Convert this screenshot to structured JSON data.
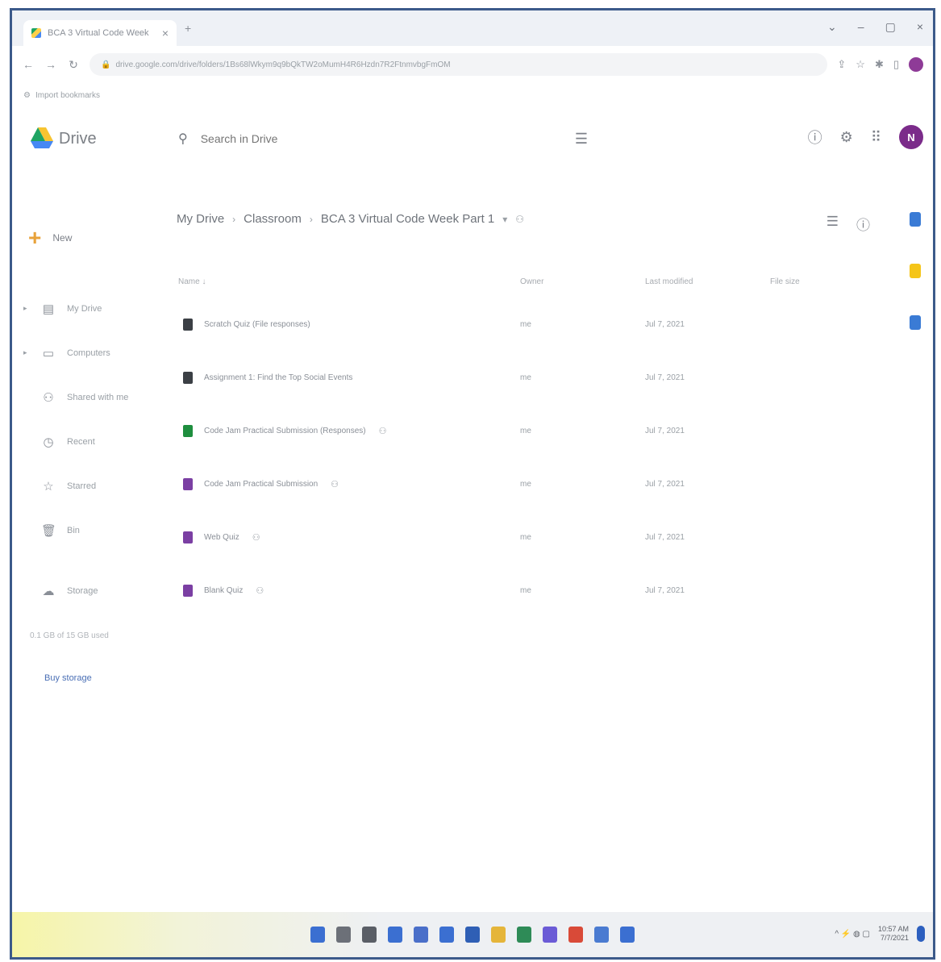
{
  "browser": {
    "tab_title": "BCA 3 Virtual Code Week",
    "tab_close": "×",
    "new_tab": "+",
    "window_controls": [
      "⌄",
      "–",
      "▢",
      "×"
    ],
    "url": "drive.google.com/drive/folders/1Bs68lWkym9q9bQkTW2oMumH4R6Hzdn7R2FtnmvbgFmOM",
    "bookmark": "Import bookmarks"
  },
  "drive": {
    "brand": "Drive",
    "search_placeholder": "Search in Drive",
    "avatar_initial": "N",
    "new_label": "New",
    "nav": [
      {
        "label": "My Drive",
        "icon": "my-drive-icon",
        "glyph": "▤",
        "caret": "▸"
      },
      {
        "label": "Computers",
        "icon": "computer-icon",
        "glyph": "▭",
        "caret": "▸"
      },
      {
        "label": "Shared with me",
        "icon": "shared-icon",
        "glyph": "⚇",
        "caret": ""
      },
      {
        "label": "Recent",
        "icon": "recent-icon",
        "glyph": "◷",
        "caret": ""
      },
      {
        "label": "Starred",
        "icon": "star-icon",
        "glyph": "☆",
        "caret": ""
      },
      {
        "label": "Bin",
        "icon": "bin-icon",
        "glyph": "🗑",
        "caret": ""
      }
    ],
    "storage_nav": {
      "label": "Storage",
      "glyph": "☁"
    },
    "storage_text": "0.1 GB of 15 GB used",
    "buy_storage": "Buy storage"
  },
  "breadcrumb": [
    "My Drive",
    "Classroom",
    "BCA 3 Virtual Code Week Part 1"
  ],
  "list": {
    "headers": {
      "name": "Name",
      "owner": "Owner",
      "modified": "Last modified",
      "size": "File size"
    },
    "rows": [
      {
        "name": "Scratch Quiz (File responses)",
        "owner": "me",
        "modified": "Jul 7, 2021",
        "type": "doc",
        "color": "#3b3f45",
        "shared": ""
      },
      {
        "name": "Assignment 1: Find the Top Social Events",
        "owner": "me",
        "modified": "Jul 7, 2021",
        "type": "doc",
        "color": "#3b3f45",
        "shared": ""
      },
      {
        "name": "Code Jam Practical Submission (Responses)",
        "owner": "me",
        "modified": "Jul 7, 2021",
        "type": "sheet",
        "color": "#1e8e3e",
        "shared": "⚇"
      },
      {
        "name": "Code Jam Practical Submission",
        "owner": "me",
        "modified": "Jul 7, 2021",
        "type": "form",
        "color": "#7b3fa3",
        "shared": "⚇"
      },
      {
        "name": "Web Quiz",
        "owner": "me",
        "modified": "Jul 7, 2021",
        "type": "form",
        "color": "#7b3fa3",
        "shared": "⚇"
      },
      {
        "name": "Blank Quiz",
        "owner": "me",
        "modified": "Jul 7, 2021",
        "type": "form",
        "color": "#7b3fa3",
        "shared": "⚇"
      }
    ]
  },
  "side_panel_colors": [
    "#3a7bd5",
    "#f5c518",
    "#3a7bd5"
  ],
  "taskbar": {
    "icons": [
      {
        "name": "windows-start-icon",
        "color": "#3b6fd1"
      },
      {
        "name": "search-icon",
        "color": "#6c7078"
      },
      {
        "name": "task-view-icon",
        "color": "#5a5e66"
      },
      {
        "name": "widgets-icon",
        "color": "#3b6fd1"
      },
      {
        "name": "chat-icon",
        "color": "#4a6fc9"
      },
      {
        "name": "files-icon",
        "color": "#3b6fd1"
      },
      {
        "name": "store-icon",
        "color": "#2f5fb5"
      },
      {
        "name": "folder-icon",
        "color": "#e5b53a"
      },
      {
        "name": "excel-icon",
        "color": "#2e8b57"
      },
      {
        "name": "notes-icon",
        "color": "#6b5bd6"
      },
      {
        "name": "chrome-icon",
        "color": "#d94a38"
      },
      {
        "name": "paint-icon",
        "color": "#4a7bd1"
      },
      {
        "name": "app-icon",
        "color": "#3b6fd1"
      }
    ],
    "tray_icons": "^ ⚡ ◍ ▢",
    "time": "10:57 AM",
    "date": "7/7/2021"
  }
}
